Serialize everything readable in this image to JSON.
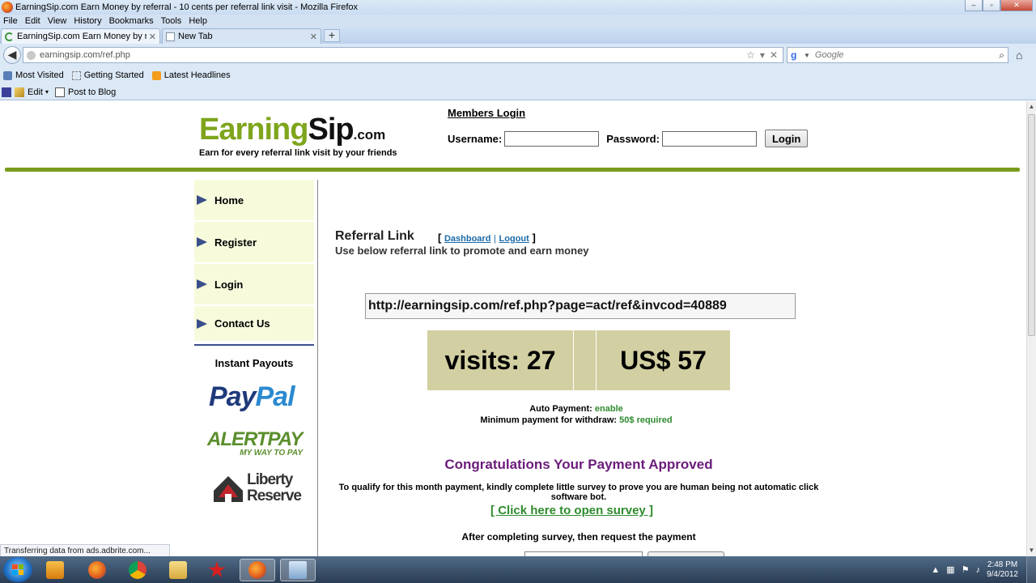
{
  "window": {
    "title": "EarningSip.com Earn Money by referral - 10 cents per referral link visit - Mozilla Firefox",
    "min": "–",
    "max": "▫",
    "close": "✕"
  },
  "menu": [
    "File",
    "Edit",
    "View",
    "History",
    "Bookmarks",
    "Tools",
    "Help"
  ],
  "tabs": [
    {
      "label": "EarningSip.com Earn Money by referr...",
      "close": "✕"
    },
    {
      "label": "New Tab",
      "close": "✕"
    }
  ],
  "new_tab": "+",
  "nav": {
    "back": "◀",
    "url": "earningsip.com/ref.php",
    "search_placeholder": "Google",
    "home": "⌂"
  },
  "bookmarks": [
    "Most Visited",
    "Getting Started",
    "Latest Headlines"
  ],
  "toolbar2": [
    "Edit",
    "Post to Blog"
  ],
  "site": {
    "logo_earning": "Earning",
    "logo_sip": "Sip",
    "logo_com": ".com",
    "tagline": "Earn for every referral link visit by your friends",
    "members_login": "Members Login",
    "username_label": "Username:",
    "password_label": "Password:",
    "login_button": "Login"
  },
  "sidebar": {
    "items": [
      "Home",
      "Register",
      "Login",
      "Contact Us"
    ],
    "payouts_title": "Instant Payouts",
    "paypal_pay": "Pay",
    "paypal_pal": "Pal",
    "alertpay_main": "ALERTPAY",
    "alertpay_sub": "MY WAY TO PAY",
    "liberty_line1": "Liberty",
    "liberty_line2": "Reserve"
  },
  "main": {
    "heading": "Referral Link",
    "bracket_open": "[",
    "bracket_close": "]",
    "dashboard_link": "Dashboard",
    "separator": "|",
    "logout_link": "Logout",
    "subheading": "Use below referral link to promote and earn money",
    "ref_url": "http://earningsip.com/ref.php?page=act/ref&invcod=40889",
    "visits": "visits: 27",
    "earnings": "US$ 57",
    "auto_payment_label": "Auto Payment:",
    "auto_payment_value": "enable",
    "min_payment_label": "Minimum payment for withdraw:",
    "min_payment_value": "50$ required",
    "congrats": "Congratulations Your Payment Approved",
    "qualify": "To qualify for this month payment, kindly complete little survey to prove you are human being not automatic click software bot.",
    "survey_link": "[ Click here to open survey ]",
    "after_survey": "After completing survey, then request the payment"
  },
  "status": "Transferring data from ads.adbrite.com...",
  "taskbar": {
    "clock_time": "2:48 PM",
    "clock_date": "9/4/2012"
  }
}
